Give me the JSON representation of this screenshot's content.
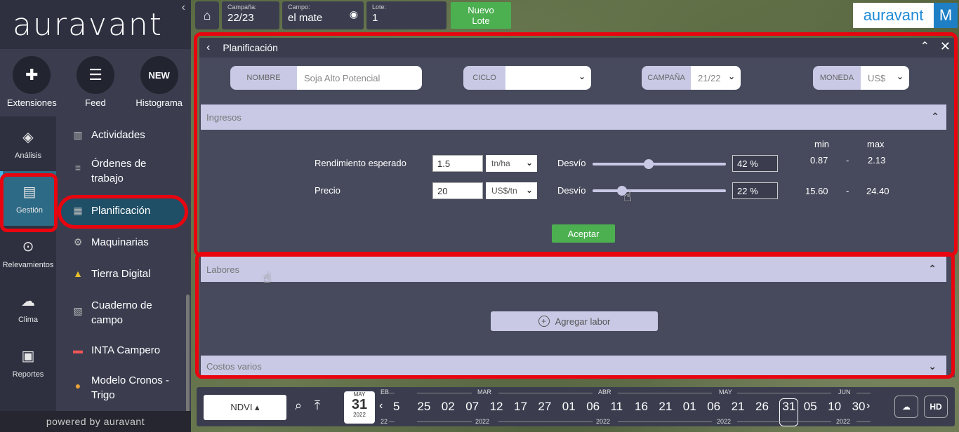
{
  "sidebar": {
    "logo": "auravant",
    "apps": [
      {
        "label": "Extensiones",
        "icon": "puzzle-icon"
      },
      {
        "label": "Feed",
        "icon": "chat-icon"
      },
      {
        "label": "Histograma",
        "badge": "NEW"
      }
    ],
    "rail": [
      {
        "label": "Análisis",
        "icon": "layers-icon"
      },
      {
        "label": "Gestión",
        "icon": "clipboard-icon"
      },
      {
        "label": "Relevamientos",
        "icon": "pin-icon"
      },
      {
        "label": "Clima",
        "icon": "cloud-icon"
      },
      {
        "label": "Reportes",
        "icon": "report-icon"
      }
    ],
    "menu": [
      {
        "label": "Actividades"
      },
      {
        "label": "Órdenes de trabajo"
      },
      {
        "label": "Planificación"
      },
      {
        "label": "Maquinarias"
      },
      {
        "label": "Tierra Digital"
      },
      {
        "label": "Cuaderno de campo"
      },
      {
        "label": "INTA Campero"
      },
      {
        "label": "Modelo Cronos - Trigo"
      }
    ],
    "powered": "powered by auravant"
  },
  "topbar": {
    "campana_label": "Campaña:",
    "campana_value": "22/23",
    "campo_label": "Campo:",
    "campo_value": "el mate",
    "lote_label": "Lote:",
    "lote_value": "1",
    "nuevo_lote": "Nuevo Lote",
    "brand": "auravant",
    "user_initial": "M"
  },
  "panel": {
    "title": "Planificación",
    "nombre_label": "NOMBRE",
    "nombre_value": "Soja Alto Potencial",
    "ciclo_label": "CICLO",
    "ciclo_value": "",
    "campana_label": "CAMPAÑA",
    "campana_value": "21/22",
    "moneda_label": "MONEDA",
    "moneda_value": "US$",
    "ingresos_title": "Ingresos",
    "min_label": "min",
    "max_label": "max",
    "rendimiento_label": "Rendimiento esperado",
    "rendimiento_value": "1.5",
    "rendimiento_unit": "tn/ha",
    "desvio_label": "Desvío",
    "rendimiento_desvio": "42 %",
    "rendimiento_desvio_fraction": 0.42,
    "rendimiento_min": "0.87",
    "rendimiento_max": "2.13",
    "precio_label": "Precio",
    "precio_value": "20",
    "precio_unit": "US$/tn",
    "precio_desvio": "22 %",
    "precio_desvio_fraction": 0.22,
    "precio_min": "15.60",
    "precio_max": "24.40",
    "dash": "-",
    "accept": "Aceptar",
    "labores_title": "Labores",
    "add_labor": "Agregar labor",
    "costos_title": "Costos varios"
  },
  "timeline": {
    "layer": "NDVI ▴",
    "cal_month": "MAY",
    "cal_day": "31",
    "cal_year": "2022",
    "months": [
      "EB",
      "MAR",
      "ABR",
      "MAY",
      "JUN"
    ],
    "dates": [
      "5",
      "25",
      "02",
      "07",
      "12",
      "17",
      "27",
      "01",
      "06",
      "11",
      "16",
      "21",
      "01",
      "06",
      "21",
      "26",
      "31",
      "05",
      "10",
      "30"
    ],
    "selected_index": 16,
    "year_labels": [
      "22",
      "2022",
      "2022",
      "2022",
      "2022"
    ],
    "hd": "HD"
  }
}
